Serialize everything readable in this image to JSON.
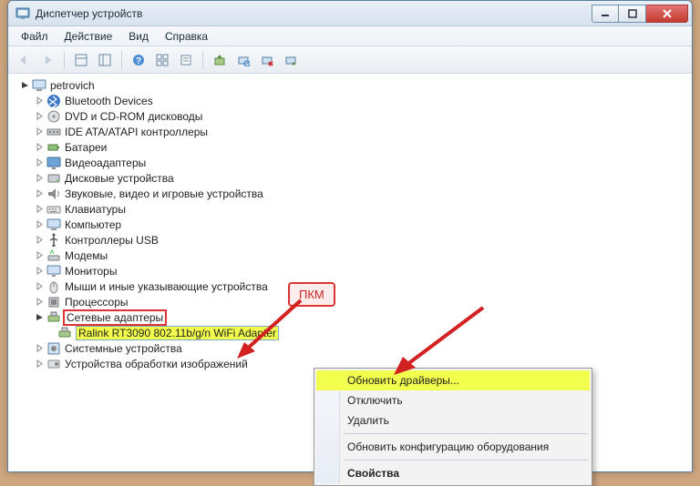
{
  "window": {
    "title": "Диспетчер устройств"
  },
  "menu": {
    "file": "Файл",
    "action": "Действие",
    "view": "Вид",
    "help": "Справка"
  },
  "tree": {
    "root": "petrovich",
    "items": [
      "Bluetooth Devices",
      "DVD и CD-ROM дисководы",
      "IDE ATA/ATAPI контроллеры",
      "Батареи",
      "Видеоадаптеры",
      "Дисковые устройства",
      "Звуковые, видео и игровые устройства",
      "Клавиатуры",
      "Компьютер",
      "Контроллеры USB",
      "Модемы",
      "Мониторы",
      "Мыши и иные указывающие устройства",
      "Процессоры",
      "Сетевые адаптеры",
      "Системные устройства",
      "Устройства обработки изображений"
    ],
    "network_child": "Ralink RT3090 802.11b/g/n WiFi Adapter"
  },
  "ctx": {
    "update": "Обновить драйверы...",
    "disable": "Отключить",
    "delete": "Удалить",
    "refresh": "Обновить конфигурацию оборудования",
    "props": "Свойства"
  },
  "annotation": {
    "label": "ПКМ"
  }
}
